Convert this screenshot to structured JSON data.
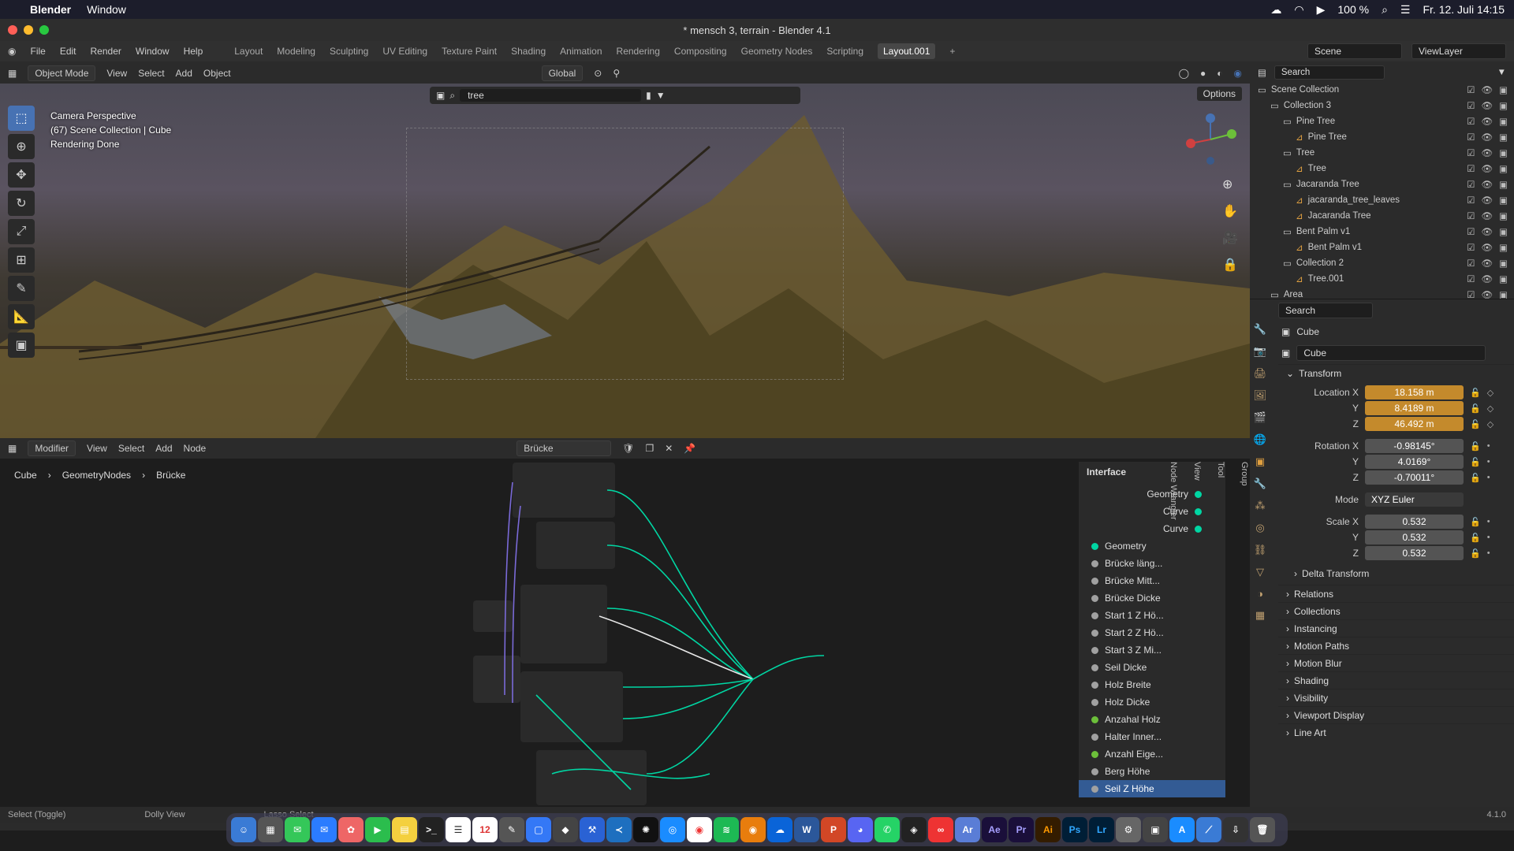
{
  "menubar": {
    "app": "Blender",
    "window": "Window",
    "battery": "100 %",
    "datetime": "Fr. 12. Juli 14:15"
  },
  "window": {
    "title": "* mensch 3, terrain - Blender 4.1"
  },
  "topbar": {
    "menus": [
      "File",
      "Edit",
      "Render",
      "Window",
      "Help"
    ],
    "workspaces": [
      "Layout",
      "Modeling",
      "Sculpting",
      "UV Editing",
      "Texture Paint",
      "Shading",
      "Animation",
      "Rendering",
      "Compositing",
      "Geometry Nodes",
      "Scripting",
      "Layout.001"
    ],
    "active_workspace": "Layout.001",
    "scene": "Scene",
    "view_layer": "ViewLayer"
  },
  "viewport_header": {
    "mode": "Object Mode",
    "menus": [
      "View",
      "Select",
      "Add",
      "Object"
    ],
    "orientation": "Global",
    "search_value": "tree",
    "options": "Options"
  },
  "viewport": {
    "info": [
      "Camera Perspective",
      "(67) Scene Collection | Cube",
      "Rendering Done"
    ],
    "tools": [
      "select-box-icon",
      "cursor-icon",
      "move-icon",
      "rotate-icon",
      "scale-icon",
      "transform-icon",
      "annotate-icon",
      "measure-icon",
      "add-cube-icon"
    ]
  },
  "node_editor": {
    "header": {
      "type": "Modifier",
      "menus": [
        "View",
        "Select",
        "Add",
        "Node"
      ],
      "tree_name": "Brücke"
    },
    "breadcrumb": [
      "Cube",
      "GeometryNodes",
      "Brücke"
    ],
    "interface": {
      "title": "Interface",
      "outputs": [
        "Geometry",
        "Curve",
        "Curve"
      ],
      "inputs": [
        "Geometry",
        "Brücke läng...",
        "Brücke Mitt...",
        "Brücke Dicke",
        "Start 1 Z Hö...",
        "Start 2 Z Hö...",
        "Start 3 Z Mi...",
        "Seil Dicke",
        "Holz Breite",
        "Holz Dicke",
        "Anzahal Holz",
        "Halter Inner...",
        "Anzahl Eige...",
        "Berg Höhe",
        "Seil Z Höhe"
      ]
    },
    "side_tabs": [
      "Group",
      "Tool",
      "View",
      "Node Wrangler"
    ]
  },
  "outliner": {
    "search_placeholder": "Search",
    "rows": [
      {
        "label": "Scene Collection",
        "indent": 0
      },
      {
        "label": "Collection 3",
        "indent": 1
      },
      {
        "label": "Pine Tree",
        "indent": 2
      },
      {
        "label": "Pine Tree",
        "indent": 3
      },
      {
        "label": "Tree",
        "indent": 2
      },
      {
        "label": "Tree",
        "indent": 3
      },
      {
        "label": "Jacaranda Tree",
        "indent": 2
      },
      {
        "label": "jacaranda_tree_leaves",
        "indent": 3
      },
      {
        "label": "Jacaranda Tree",
        "indent": 3
      },
      {
        "label": "Bent Palm v1",
        "indent": 2
      },
      {
        "label": "Bent Palm v1",
        "indent": 3
      },
      {
        "label": "Collection 2",
        "indent": 2
      },
      {
        "label": "Tree.001",
        "indent": 3
      },
      {
        "label": "Area",
        "indent": 1
      }
    ]
  },
  "properties": {
    "search_placeholder": "Search",
    "object": "Cube",
    "object_field": "Cube",
    "transform_title": "Transform",
    "location": {
      "label": "Location X",
      "x": "18.158 m",
      "y": "8.4189 m",
      "z": "46.492 m"
    },
    "rotation": {
      "label": "Rotation X",
      "x": "-0.98145°",
      "y": "4.0169°",
      "z": "-0.70011°"
    },
    "mode": {
      "label": "Mode",
      "value": "XYZ Euler"
    },
    "scale": {
      "label": "Scale X",
      "x": "0.532",
      "y": "0.532",
      "z": "0.532"
    },
    "axis_y": "Y",
    "axis_z": "Z",
    "delta": "Delta Transform",
    "panels": [
      "Relations",
      "Collections",
      "Instancing",
      "Motion Paths",
      "Motion Blur",
      "Shading",
      "Visibility",
      "Viewport Display",
      "Line Art"
    ]
  },
  "statusbar": {
    "left": "Select (Toggle)",
    "middle": "Dolly View",
    "right": "Lasso Select",
    "version": "4.1.0"
  },
  "colors": {
    "accent": "#4772b3",
    "keyframe": "#c48a2c",
    "geo_socket": "#00d6a3",
    "float_socket": "#a1a1a1"
  }
}
